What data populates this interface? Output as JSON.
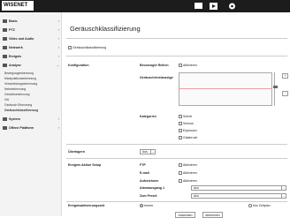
{
  "app": {
    "logo": "WISENET"
  },
  "sidebar": {
    "items": [
      {
        "label": "Basic",
        "chev": "›"
      },
      {
        "label": "PTZ",
        "chev": "›"
      },
      {
        "label": "Video und Audio",
        "chev": "›"
      },
      {
        "label": "Netzwerk",
        "chev": "›"
      },
      {
        "label": "Ereignis",
        "chev": "›"
      },
      {
        "label": "Analyse",
        "chev": "⌄"
      },
      {
        "label": "System",
        "chev": "›"
      },
      {
        "label": "Offene Plattform",
        "chev": "›"
      }
    ],
    "subitems": [
      "Bewegungserkennung",
      "Manipulationserkennung",
      "Verschiebungserkennung",
      "Nebelerkennung",
      "Gesichtserkennung",
      "IVA",
      "Geräusch Erkennung",
      "Geräuschklassifizierung"
    ]
  },
  "main": {
    "title": "Geräuschklassifizierung",
    "enable_label": "Geräuschklassifizierung",
    "config_label": "Konfiguration",
    "rows": {
      "select_all": "Bevorzugte Reihen",
      "select_all_opt": "Aktivieren",
      "level": "Geräuschlevelanzeige",
      "categories_label": "Kategorien",
      "categories": [
        "Schrei",
        "Schuss",
        "Explosion",
        "Glasbruch"
      ]
    },
    "overlay_label": "Überlagern",
    "overlay_value": "Aus",
    "event_setup": "Ereignis Aktion Setup",
    "event_rows": [
      {
        "label": "FTP",
        "opt": "Aktivieren"
      },
      {
        "label": "E-mail",
        "opt": "Aktivieren"
      },
      {
        "label": "Aufzeichnen",
        "opt": "Aktivieren"
      }
    ],
    "alarm_label": "Alarmausgang 1",
    "alarm_value": "Aus",
    "preset_label": "Zum Preset",
    "preset_value": "Aus",
    "schedule_label": "Ereignisaktivierungszeit",
    "schedule_always": "Immer",
    "schedule_only": "Nur Zeitplan",
    "apply": "Anwenden",
    "cancel": "Abbrechen"
  }
}
